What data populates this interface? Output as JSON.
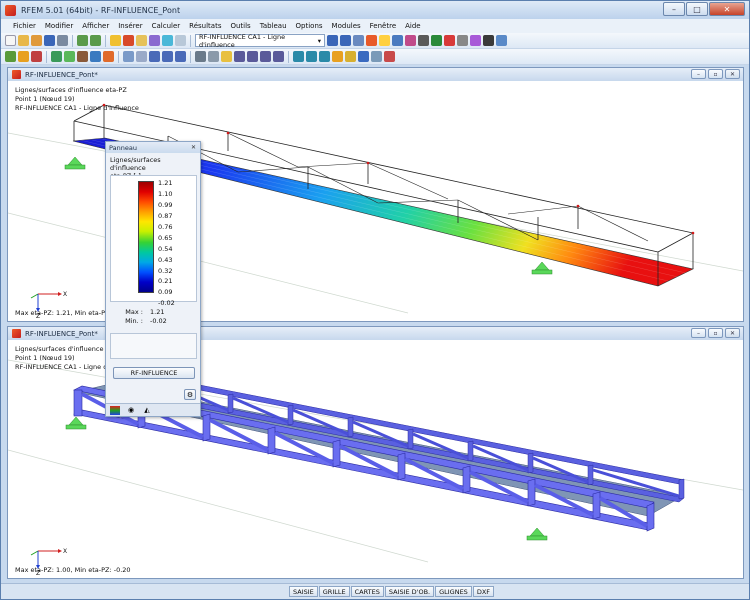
{
  "window": {
    "title": "RFEM 5.01 (64bit) - RF-INFLUENCE_Pont"
  },
  "menu": [
    "Fichier",
    "Modifier",
    "Afficher",
    "Insérer",
    "Calculer",
    "Résultats",
    "Outils",
    "Tableau",
    "Options",
    "Modules",
    "Fenêtre",
    "Aide"
  ],
  "toolbar": {
    "case_combo": "RF-INFLUENCE CA1 - Ligne d'influence"
  },
  "view1": {
    "title": "RF-INFLUENCE_Pont*",
    "info_lines": [
      "Lignes/surfaces d'influence eta-PZ",
      "Point 1 (Nœud 19)",
      "RF-INFLUENCE CA1 - Ligne d'influence"
    ],
    "bottom": "Max eta-PZ: 1.21, Min eta-PZ: -0"
  },
  "view2": {
    "title": "RF-INFLUENCE_Pont*",
    "info_lines": [
      "Lignes/surfaces d'influence eta",
      "Point 1 (Nœud 19)",
      "RF-INFLUENCE CA1 - Ligne d'in"
    ],
    "bottom": "Max eta-PZ: 1.00, Min eta-PZ: -0.20"
  },
  "axes": {
    "x": "X",
    "z": "Z"
  },
  "panel": {
    "title": "Panneau",
    "header": [
      "Lignes/surfaces d'influence",
      "eta-PZ [-]"
    ],
    "scale": [
      "1.21",
      "1.10",
      "0.99",
      "0.87",
      "0.76",
      "0.65",
      "0.54",
      "0.43",
      "0.32",
      "0.21",
      "0.09",
      "-0.02"
    ],
    "max_label": "Max :",
    "max_value": "1.21",
    "min_label": "Min. :",
    "min_value": "-0.02",
    "button": "RF-INFLUENCE"
  },
  "status_tabs": [
    "SAISIE",
    "GRILLE",
    "CARTES",
    "SAISIE D'OB.",
    "GLIGNES",
    "DXF"
  ]
}
